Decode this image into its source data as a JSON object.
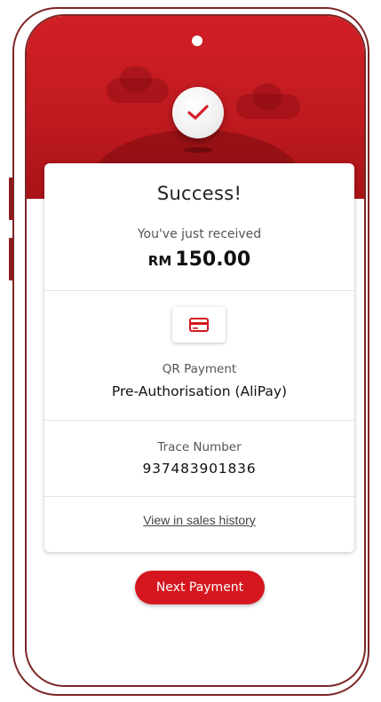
{
  "header": {
    "accent_color": "#d21f26",
    "status_icon": "check-icon"
  },
  "result": {
    "title": "Success!",
    "received_label": "You've just received",
    "currency": "RM",
    "amount": "150.00"
  },
  "payment": {
    "icon": "credit-card-icon",
    "type_label": "QR Payment",
    "method": "Pre-Authorisation (AliPay)"
  },
  "trace": {
    "label": "Trace Number",
    "number": "937483901836"
  },
  "links": {
    "sales_history": "View in sales history"
  },
  "actions": {
    "next_payment": "Next Payment"
  }
}
